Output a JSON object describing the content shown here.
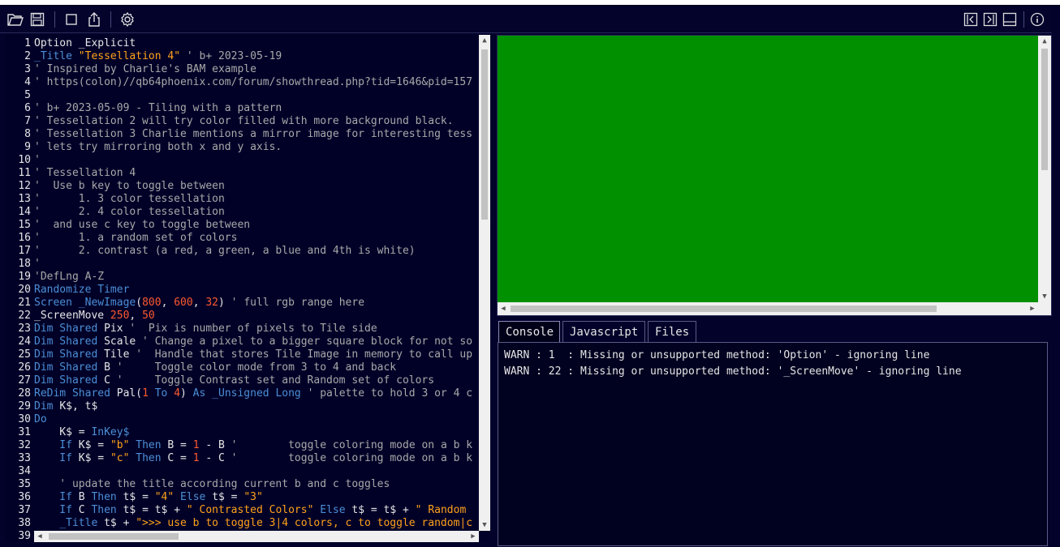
{
  "toolbar": {
    "icons": [
      "open-folder-icon",
      "save-icon",
      "new-window-icon",
      "share-icon",
      "settings-gear-icon",
      "collapse-left-icon",
      "collapse-right-icon",
      "panel-bottom-icon",
      "info-icon"
    ]
  },
  "editor": {
    "line_numbers": [
      "1",
      "2",
      "3",
      "4",
      "5",
      "6",
      "7",
      "8",
      "9",
      "10",
      "11",
      "12",
      "13",
      "14",
      "15",
      "16",
      "17",
      "18",
      "19",
      "20",
      "21",
      "22",
      "23",
      "24",
      "25",
      "26",
      "27",
      "28",
      "29",
      "30",
      "31",
      "32",
      "33",
      "34",
      "35",
      "36",
      "37",
      "38",
      "39"
    ],
    "lines": [
      [
        {
          "t": "Option _Explicit",
          "c": "fn"
        }
      ],
      [
        {
          "t": "_Title ",
          "c": "kw"
        },
        {
          "t": "\"Tessellation 4\"",
          "c": "str"
        },
        {
          "t": " ' b+ 2023-05-19",
          "c": "cm"
        }
      ],
      [
        {
          "t": "' Inspired by Charlie's BAM example",
          "c": "cm"
        }
      ],
      [
        {
          "t": "' https(colon)//qb64phoenix.com/forum/showthread.php?tid=1646&pid=157",
          "c": "cm"
        }
      ],
      [
        {
          "t": "",
          "c": "cm"
        }
      ],
      [
        {
          "t": "' b+ 2023-05-09 - Tiling with a pattern",
          "c": "cm"
        }
      ],
      [
        {
          "t": "' Tessellation 2 will try color filled with more background black.",
          "c": "cm"
        }
      ],
      [
        {
          "t": "' Tessellation 3 Charlie mentions a mirror image for interesting tess",
          "c": "cm"
        }
      ],
      [
        {
          "t": "' lets try mirroring both x and y axis.",
          "c": "cm"
        }
      ],
      [
        {
          "t": "'",
          "c": "cm"
        }
      ],
      [
        {
          "t": "' Tessellation 4",
          "c": "cm"
        }
      ],
      [
        {
          "t": "'  Use b key to toggle between",
          "c": "cm"
        }
      ],
      [
        {
          "t": "'      1. 3 color tessellation",
          "c": "cm"
        }
      ],
      [
        {
          "t": "'      2. 4 color tessellation",
          "c": "cm"
        }
      ],
      [
        {
          "t": "'  and use c key to toggle between",
          "c": "cm"
        }
      ],
      [
        {
          "t": "'      1. a random set of colors",
          "c": "cm"
        }
      ],
      [
        {
          "t": "'      2. contrast (a red, a green, a blue and 4th is white)",
          "c": "cm"
        }
      ],
      [
        {
          "t": "'",
          "c": "cm"
        }
      ],
      [
        {
          "t": "'DefLng A-Z",
          "c": "cm"
        }
      ],
      [
        {
          "t": "Randomize Timer",
          "c": "kw"
        }
      ],
      [
        {
          "t": "Screen ",
          "c": "kw"
        },
        {
          "t": "_NewImage",
          "c": "kw"
        },
        {
          "t": "(",
          "c": "fn"
        },
        {
          "t": "800",
          "c": "num"
        },
        {
          "t": ", ",
          "c": "fn"
        },
        {
          "t": "600",
          "c": "num"
        },
        {
          "t": ", ",
          "c": "fn"
        },
        {
          "t": "32",
          "c": "num"
        },
        {
          "t": ")",
          "c": "fn"
        },
        {
          "t": " ' full rgb range here",
          "c": "cm"
        }
      ],
      [
        {
          "t": "_ScreenMove ",
          "c": "fn"
        },
        {
          "t": "250",
          "c": "num"
        },
        {
          "t": ", ",
          "c": "fn"
        },
        {
          "t": "50",
          "c": "num"
        }
      ],
      [
        {
          "t": "Dim Shared ",
          "c": "kw"
        },
        {
          "t": "Pix",
          "c": "fn"
        },
        {
          "t": " '  Pix is number of pixels to Tile side",
          "c": "cm"
        }
      ],
      [
        {
          "t": "Dim Shared ",
          "c": "kw"
        },
        {
          "t": "Scale",
          "c": "fn"
        },
        {
          "t": " ' Change a pixel to a bigger square block for not so",
          "c": "cm"
        }
      ],
      [
        {
          "t": "Dim Shared ",
          "c": "kw"
        },
        {
          "t": "Tile",
          "c": "fn"
        },
        {
          "t": " '  Handle that stores Tile Image in memory to call up",
          "c": "cm"
        }
      ],
      [
        {
          "t": "Dim Shared ",
          "c": "kw"
        },
        {
          "t": "B",
          "c": "fn"
        },
        {
          "t": " '     Toggle color mode from 3 to 4 and back",
          "c": "cm"
        }
      ],
      [
        {
          "t": "Dim Shared ",
          "c": "kw"
        },
        {
          "t": "C",
          "c": "fn"
        },
        {
          "t": " '     Toggle Contrast set and Random set of colors",
          "c": "cm"
        }
      ],
      [
        {
          "t": "ReDim Shared ",
          "c": "kw"
        },
        {
          "t": "Pal(",
          "c": "fn"
        },
        {
          "t": "1",
          "c": "num"
        },
        {
          "t": " To ",
          "c": "kw"
        },
        {
          "t": "4",
          "c": "num"
        },
        {
          "t": ")",
          "c": "fn"
        },
        {
          "t": " As ",
          "c": "kw"
        },
        {
          "t": "_Unsigned Long",
          "c": "kw"
        },
        {
          "t": " ' palette to hold 3 or 4 c",
          "c": "cm"
        }
      ],
      [
        {
          "t": "Dim ",
          "c": "kw"
        },
        {
          "t": "K$, t$",
          "c": "fn"
        }
      ],
      [
        {
          "t": "Do",
          "c": "kw"
        }
      ],
      [
        {
          "t": "    K$ = ",
          "c": "fn"
        },
        {
          "t": "InKey$",
          "c": "kw"
        }
      ],
      [
        {
          "t": "    If ",
          "c": "kw"
        },
        {
          "t": "K$ = ",
          "c": "fn"
        },
        {
          "t": "\"b\"",
          "c": "str"
        },
        {
          "t": " Then ",
          "c": "kw"
        },
        {
          "t": "B = ",
          "c": "fn"
        },
        {
          "t": "1",
          "c": "num"
        },
        {
          "t": " - B",
          "c": "fn"
        },
        {
          "t": " '        toggle coloring mode on a b k",
          "c": "cm"
        }
      ],
      [
        {
          "t": "    If ",
          "c": "kw"
        },
        {
          "t": "K$ = ",
          "c": "fn"
        },
        {
          "t": "\"c\"",
          "c": "str"
        },
        {
          "t": " Then ",
          "c": "kw"
        },
        {
          "t": "C = ",
          "c": "fn"
        },
        {
          "t": "1",
          "c": "num"
        },
        {
          "t": " - C",
          "c": "fn"
        },
        {
          "t": " '        toggle coloring mode on a b k",
          "c": "cm"
        }
      ],
      [
        {
          "t": "",
          "c": "fn"
        }
      ],
      [
        {
          "t": "    ' update the title according current b and c toggles",
          "c": "cm"
        }
      ],
      [
        {
          "t": "    If ",
          "c": "kw"
        },
        {
          "t": "B",
          "c": "fn"
        },
        {
          "t": " Then ",
          "c": "kw"
        },
        {
          "t": "t$ = ",
          "c": "fn"
        },
        {
          "t": "\"4\"",
          "c": "str"
        },
        {
          "t": " Else ",
          "c": "kw"
        },
        {
          "t": "t$ = ",
          "c": "fn"
        },
        {
          "t": "\"3\"",
          "c": "str"
        }
      ],
      [
        {
          "t": "    If ",
          "c": "kw"
        },
        {
          "t": "C",
          "c": "fn"
        },
        {
          "t": " Then ",
          "c": "kw"
        },
        {
          "t": "t$ = t$ + ",
          "c": "fn"
        },
        {
          "t": "\" Contrasted Colors\"",
          "c": "str"
        },
        {
          "t": " Else ",
          "c": "kw"
        },
        {
          "t": "t$ = t$ + ",
          "c": "fn"
        },
        {
          "t": "\" Random",
          "c": "str"
        }
      ],
      [
        {
          "t": "    _Title ",
          "c": "kw"
        },
        {
          "t": "t$ + ",
          "c": "fn"
        },
        {
          "t": "\">>> use b to toggle 3|4 colors, c to toggle random|c",
          "c": "str"
        }
      ],
      [
        {
          "t": "",
          "c": "fn"
        }
      ]
    ]
  },
  "tabs": [
    "Console",
    "Javascript",
    "Files"
  ],
  "console": {
    "logs": [
      {
        "level": "WARN",
        "line": "1",
        "message": "Missing or unsupported method: 'Option' - ignoring line"
      },
      {
        "level": "WARN",
        "line": "22",
        "message": "Missing or unsupported method: '_ScreenMove' - ignoring line"
      }
    ]
  },
  "colors": {
    "background": "#02022a",
    "keyword": "#4c8fd6",
    "string": "#ffa21a",
    "number": "#ff5a2e",
    "comment": "#a9a9a9",
    "canvas": "#009000"
  }
}
